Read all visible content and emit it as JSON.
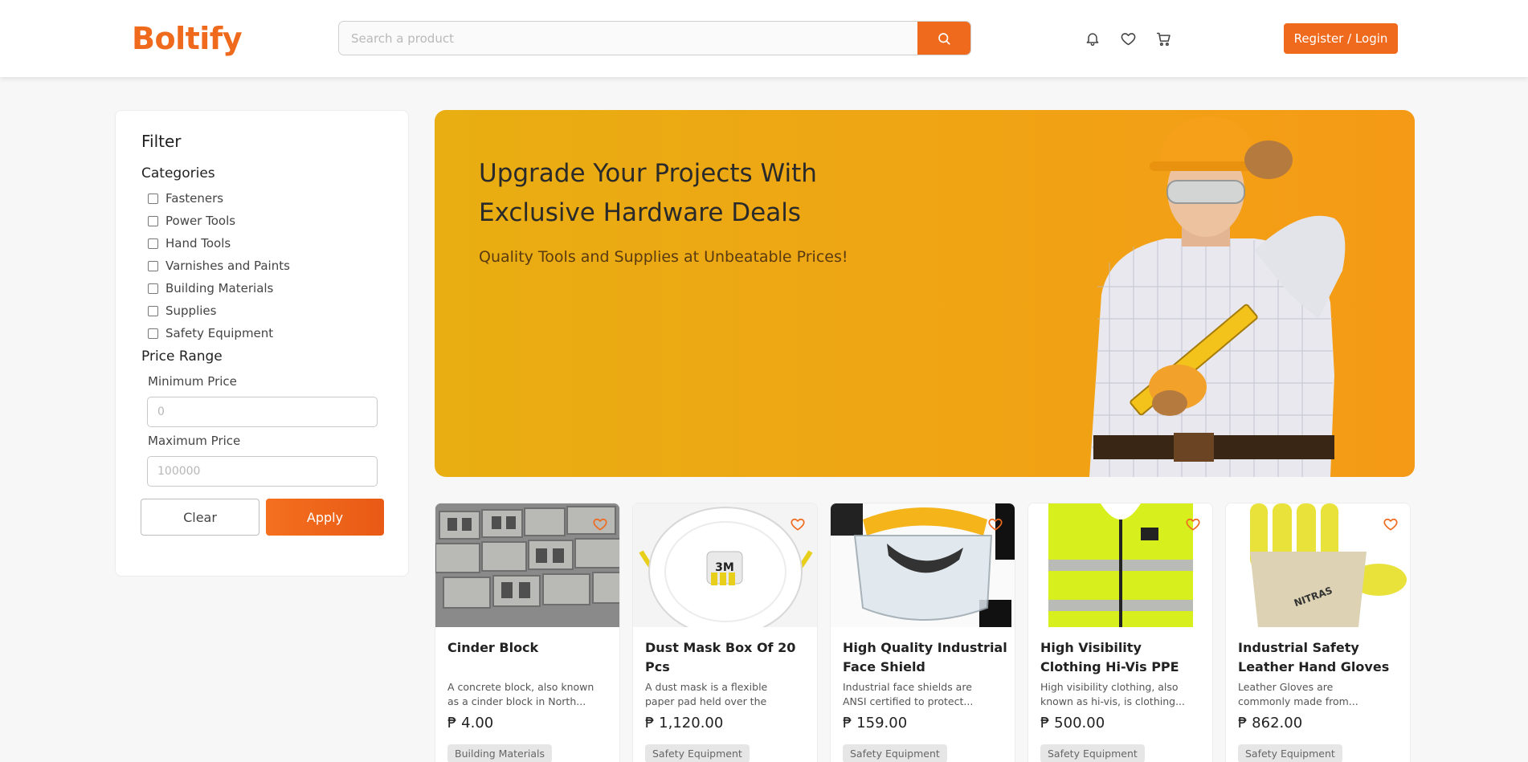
{
  "header": {
    "logo": "Boltify",
    "search_placeholder": "Search a product",
    "icons": [
      "search-icon",
      "bell-icon",
      "heart-icon",
      "cart-icon"
    ],
    "login_label": "Register / Login"
  },
  "filter": {
    "title": "Filter",
    "categories_title": "Categories",
    "categories": [
      "Fasteners",
      "Power Tools",
      "Hand Tools",
      "Varnishes and Paints",
      "Building Materials",
      "Supplies",
      "Safety Equipment"
    ],
    "price_title": "Price Range",
    "min_label": "Minimum Price",
    "min_placeholder": "0",
    "max_label": "Maximum Price",
    "max_placeholder": "100000",
    "clear_label": "Clear",
    "apply_label": "Apply"
  },
  "banner": {
    "title": "Upgrade Your Projects With Exclusive Hardware Deals",
    "subtitle": "Quality Tools and Supplies at Unbeatable Prices!"
  },
  "products": [
    {
      "name": "Cinder Block",
      "description": "A concrete block, also known as a cinder block in North...",
      "price": "₱ 4.00",
      "category": "Building Materials",
      "image": "cinder-blocks"
    },
    {
      "name": "Dust Mask Box Of 20 Pcs",
      "description": "A dust mask is a flexible paper pad held over the nos...",
      "price": "₱ 1,120.00",
      "category": "Safety Equipment",
      "image": "dust-mask"
    },
    {
      "name": "High Quality Industrial Face Shield",
      "description": "Industrial face shields are ANSI certified to protect...",
      "price": "₱ 159.00",
      "category": "Safety Equipment",
      "image": "face-shield"
    },
    {
      "name": "High Visibility Clothing Hi-Vis PPE",
      "description": "High visibility clothing, also known as hi-vis, is clothing...",
      "price": "₱ 500.00",
      "category": "Safety Equipment",
      "image": "hi-vis-vest"
    },
    {
      "name": "Industrial Safety Leather Hand Gloves",
      "description": "Leather Gloves are commonly made from...",
      "price": "₱ 862.00",
      "category": "Safety Equipment",
      "image": "leather-gloves"
    }
  ],
  "colors": {
    "accent": "#ef6a1d",
    "banner": "#f0a414"
  }
}
